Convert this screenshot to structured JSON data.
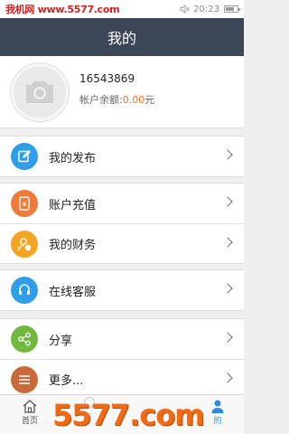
{
  "status_bar": {
    "watermark": "我机网 www.5577.com",
    "time": "20:23"
  },
  "header": {
    "title": "我的"
  },
  "profile": {
    "user_id": "16543869",
    "balance_label": "帐户余额:",
    "balance_value": "0.00",
    "balance_unit": "元"
  },
  "menu": {
    "publish": {
      "label": "我的发布",
      "color": "#2f9ee6"
    },
    "recharge": {
      "label": "账户充值",
      "color": "#f07a3a"
    },
    "finance": {
      "label": "我的财务",
      "color": "#f4a623"
    },
    "service": {
      "label": "在线客服",
      "color": "#2f9ee6"
    },
    "share": {
      "label": "分享",
      "color": "#71b83f"
    },
    "more": {
      "label": "更多...",
      "color": "#c96a3a"
    }
  },
  "tabbar": {
    "home_label": "首页",
    "mine_label": "的"
  },
  "watermark": {
    "brand": "5577.com"
  }
}
